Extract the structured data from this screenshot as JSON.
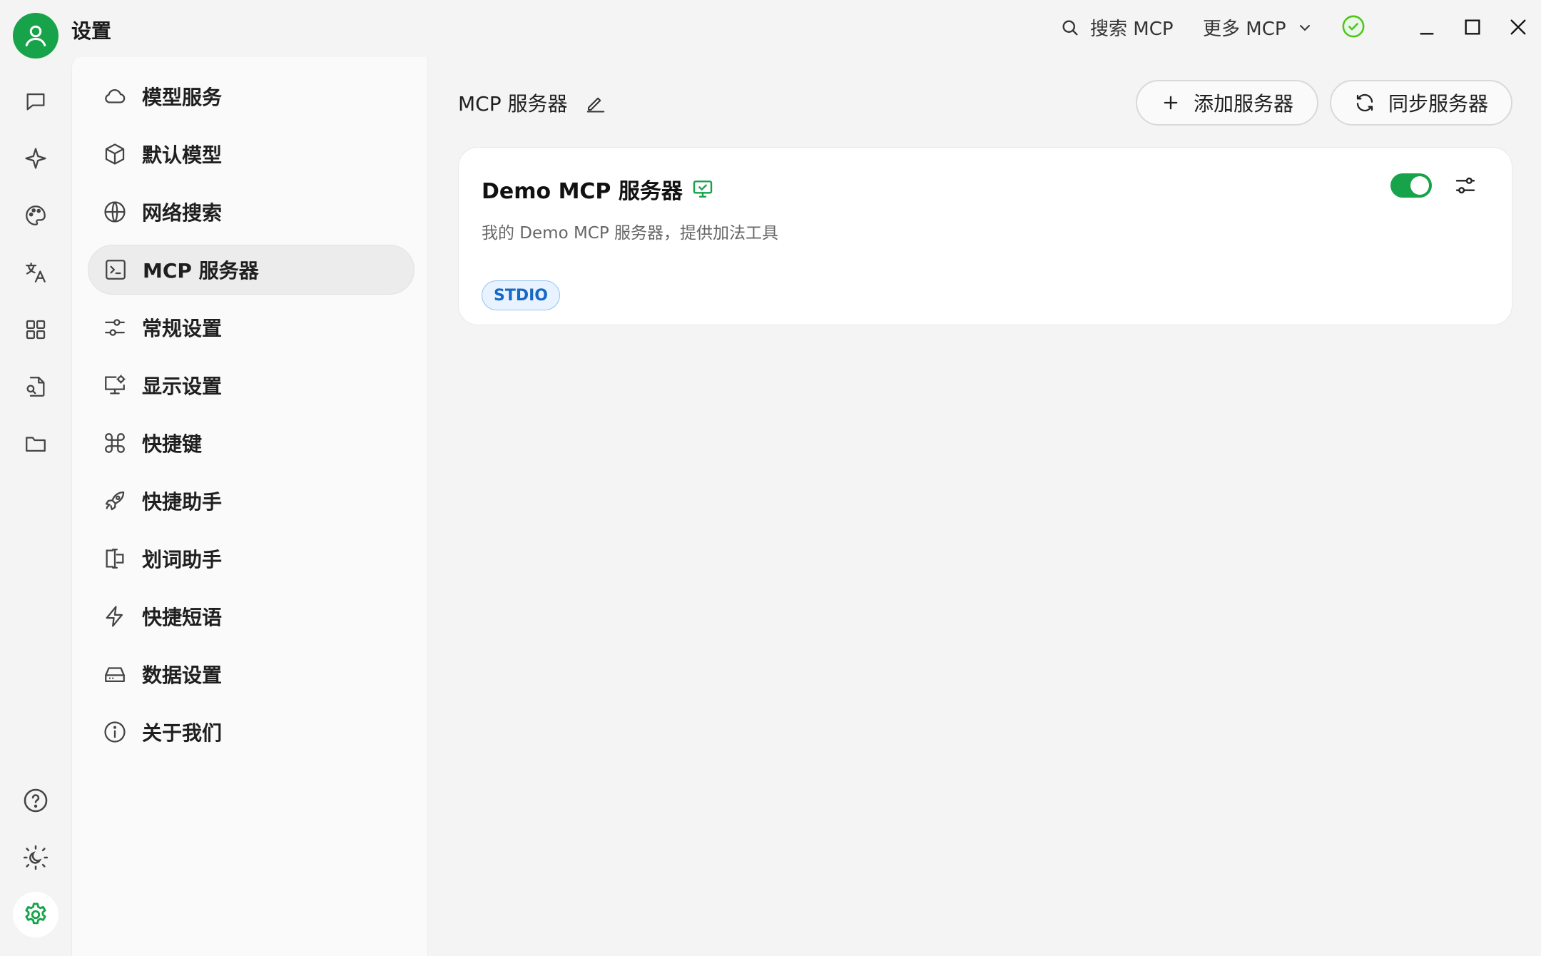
{
  "titlebar": {
    "app_title": "设置",
    "search_label": "搜索 MCP",
    "more_label": "更多 MCP",
    "icons": [
      "user-avatar-icon",
      "search-icon",
      "chevron-down-icon",
      "check-circle-icon",
      "minimize-icon",
      "maximize-icon",
      "close-icon"
    ]
  },
  "rail": {
    "items": [
      "chat-icon",
      "sparkle-icon",
      "palette-icon",
      "translate-icon",
      "apps-grid-icon",
      "file-search-icon",
      "folder-icon"
    ],
    "bottom": [
      "help-icon",
      "theme-toggle-icon",
      "settings-icon"
    ]
  },
  "nav": {
    "items": [
      {
        "label": "模型服务",
        "icon": "cloud-icon"
      },
      {
        "label": "默认模型",
        "icon": "cube-icon"
      },
      {
        "label": "网络搜索",
        "icon": "globe-icon"
      },
      {
        "label": "MCP 服务器",
        "icon": "terminal-icon"
      },
      {
        "label": "常规设置",
        "icon": "sliders-icon"
      },
      {
        "label": "显示设置",
        "icon": "monitor-settings-icon"
      },
      {
        "label": "快捷键",
        "icon": "command-icon"
      },
      {
        "label": "快捷助手",
        "icon": "rocket-icon"
      },
      {
        "label": "划词助手",
        "icon": "text-cursor-icon"
      },
      {
        "label": "快捷短语",
        "icon": "lightning-icon"
      },
      {
        "label": "数据设置",
        "icon": "hard-drive-icon"
      },
      {
        "label": "关于我们",
        "icon": "info-icon"
      }
    ],
    "active_index": 3
  },
  "main": {
    "title": "MCP 服务器",
    "add_button": "添加服务器",
    "sync_button": "同步服务器"
  },
  "server_card": {
    "name": "Demo MCP 服务器",
    "description": "我的 Demo MCP 服务器，提供加法工具",
    "tag": "STDIO",
    "enabled": true
  },
  "colors": {
    "accent": "#16a34a",
    "tag_text": "#1668c7",
    "tag_bg": "#e8f3ff"
  }
}
